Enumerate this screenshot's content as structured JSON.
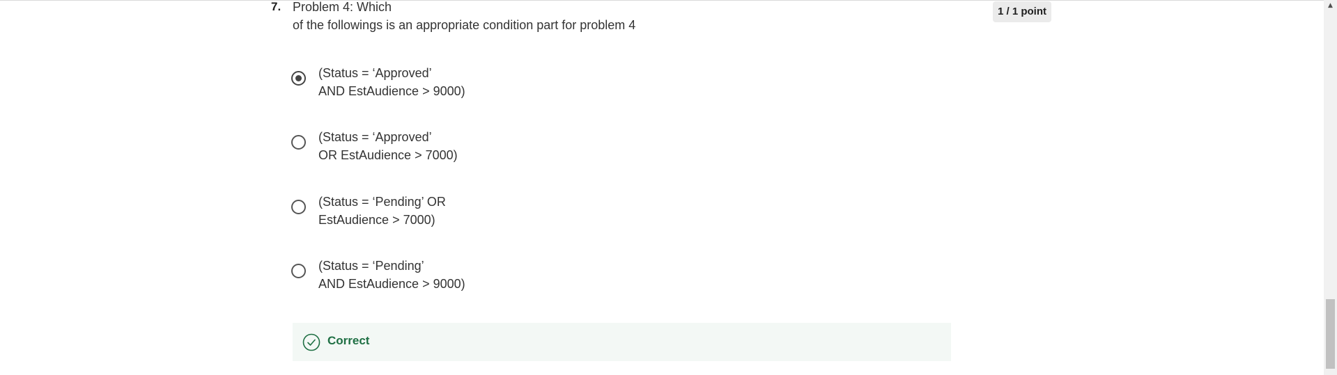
{
  "question": {
    "number": "7.",
    "text": "Problem 4: Which of the followings is an appropriate condition part for problem 4",
    "text_line1": "Problem 4: Which",
    "text_line2": "of the followings is an appropriate condition part for problem 4",
    "score": "1 / 1 point"
  },
  "options": [
    {
      "line1": "(Status = ‘Approved’",
      "line2": "AND EstAudience > 9000)",
      "selected": true
    },
    {
      "line1": "(Status = ‘Approved’",
      "line2": "OR EstAudience > 7000)",
      "selected": false
    },
    {
      "line1": "(Status = ‘Pending’ OR",
      "line2": "EstAudience > 7000)",
      "selected": false
    },
    {
      "line1": "(Status = ‘Pending’",
      "line2": "AND EstAudience > 9000)",
      "selected": false
    }
  ],
  "feedback": {
    "label": "Correct",
    "icon": "check-circle-icon",
    "color": "#1e6f43",
    "background": "#f3f8f5"
  },
  "scrollbar": {
    "up_arrow": "▲"
  }
}
